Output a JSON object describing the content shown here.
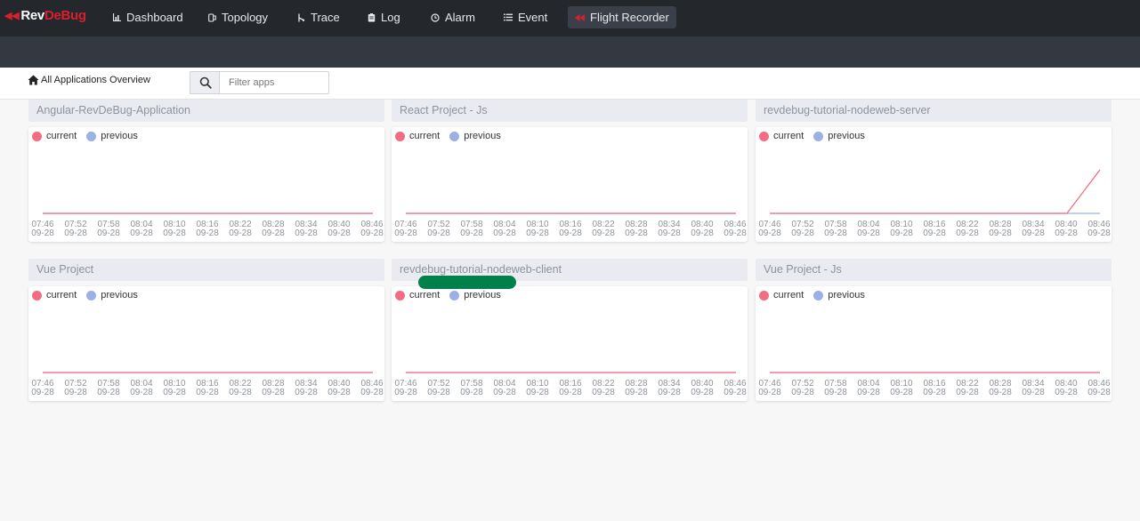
{
  "brand": {
    "rev": "Rev",
    "debug": "DeBug"
  },
  "nav": [
    {
      "label": "Dashboard",
      "icon": "bar-chart-icon"
    },
    {
      "label": "Topology",
      "icon": "topology-icon"
    },
    {
      "label": "Trace",
      "icon": "trace-icon"
    },
    {
      "label": "Log",
      "icon": "log-icon"
    },
    {
      "label": "Alarm",
      "icon": "alarm-icon"
    },
    {
      "label": "Event",
      "icon": "list-icon"
    },
    {
      "label": "Flight Recorder",
      "icon": "rewind-icon",
      "active": true
    }
  ],
  "toolbar": {
    "overview_label": "All Applications Overview",
    "search_placeholder": "Filter apps"
  },
  "legend": {
    "current": "current",
    "previous": "previous"
  },
  "colors": {
    "current": "#f36c82",
    "previous": "#9cb0e6",
    "accent": "#d8202a"
  },
  "time_ticks": [
    [
      "07:46",
      "09-28"
    ],
    [
      "07:52",
      "09-28"
    ],
    [
      "07:58",
      "09-28"
    ],
    [
      "08:04",
      "09-28"
    ],
    [
      "08:10",
      "09-28"
    ],
    [
      "08:16",
      "09-28"
    ],
    [
      "08:22",
      "09-28"
    ],
    [
      "08:28",
      "09-28"
    ],
    [
      "08:34",
      "09-28"
    ],
    [
      "08:40",
      "09-28"
    ],
    [
      "08:46",
      "09-28"
    ]
  ],
  "apps": [
    {
      "name": "Angular-RevDeBug-Application",
      "current_values": [
        0,
        0,
        0,
        0,
        0,
        0,
        0,
        0,
        0,
        0,
        0
      ],
      "previous_values": [
        0,
        0,
        0,
        0,
        0,
        0,
        0,
        0,
        0,
        0,
        0
      ]
    },
    {
      "name": "React Project - Js",
      "current_values": [
        0,
        0,
        0,
        0,
        0,
        0,
        0,
        0,
        0,
        0,
        0
      ],
      "previous_values": [
        0,
        0,
        0,
        0,
        0,
        0,
        0,
        0,
        0,
        0,
        0
      ]
    },
    {
      "name": "revdebug-tutorial-nodeweb-server",
      "current_values": [
        0,
        0,
        0,
        0,
        0,
        0,
        0,
        0,
        0,
        0,
        1
      ],
      "previous_values": [
        0,
        0,
        0,
        0,
        0,
        0,
        0,
        0,
        0,
        0,
        0
      ]
    },
    {
      "name": "Vue Project",
      "current_values": [
        0,
        0,
        0,
        0,
        0,
        0,
        0,
        0,
        0,
        0,
        0
      ],
      "previous_values": [
        0,
        0,
        0,
        0,
        0,
        0,
        0,
        0,
        0,
        0,
        0
      ]
    },
    {
      "name": "revdebug-tutorial-nodeweb-client",
      "current_values": [
        0,
        0,
        0,
        0,
        0,
        0,
        0,
        0,
        0,
        0,
        0
      ],
      "previous_values": [
        0,
        0,
        0,
        0,
        0,
        0,
        0,
        0,
        0,
        0,
        0
      ]
    },
    {
      "name": "Vue Project - Js",
      "current_values": [
        0,
        0,
        0,
        0,
        0,
        0,
        0,
        0,
        0,
        0,
        0
      ],
      "previous_values": [
        0,
        0,
        0,
        0,
        0,
        0,
        0,
        0,
        0,
        0,
        0
      ]
    }
  ]
}
